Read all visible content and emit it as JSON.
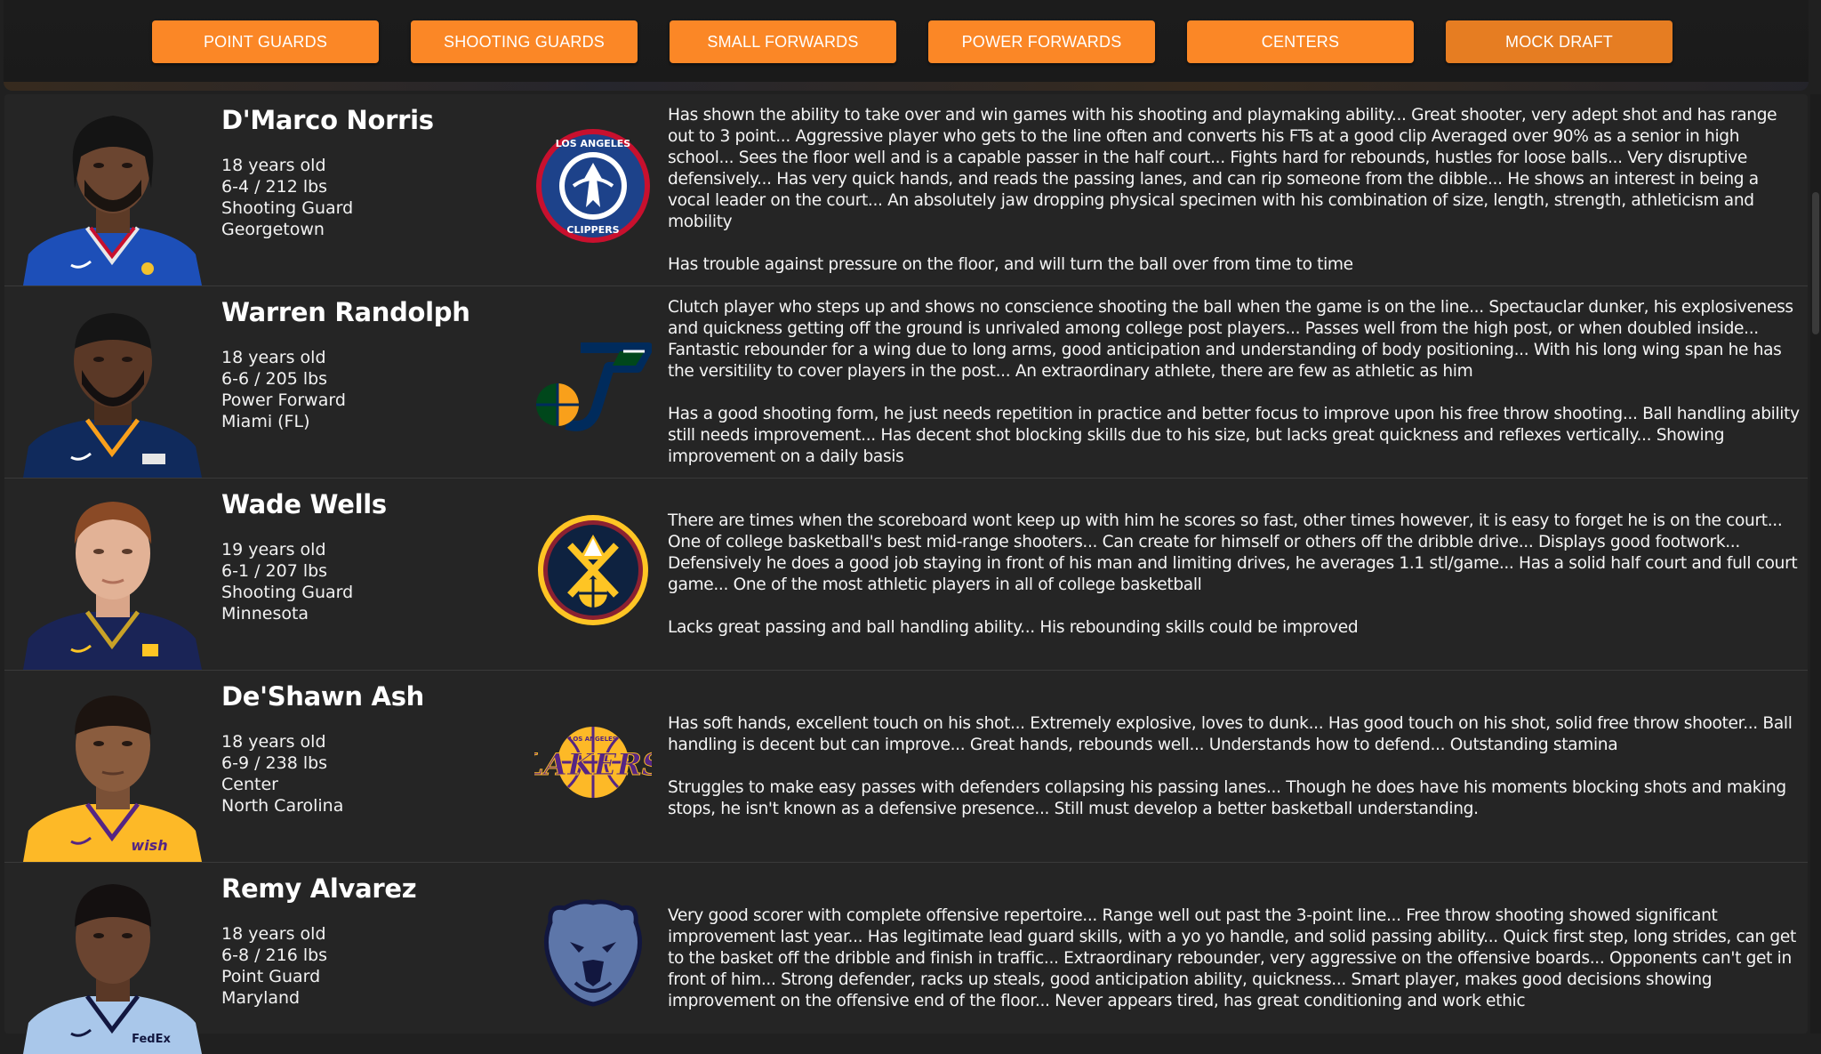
{
  "nav": {
    "buttons": [
      "POINT GUARDS",
      "SHOOTING GUARDS",
      "SMALL FORWARDS",
      "POWER FORWARDS",
      "CENTERS",
      "MOCK DRAFT"
    ]
  },
  "colors": {
    "accent": "#fb8726",
    "background": "#202020",
    "row_background": "#252525"
  },
  "players": [
    {
      "name": "D'Marco Norris",
      "age": "18 years old",
      "size": "6-4 / 212 lbs",
      "position": "Shooting Guard",
      "school": "Georgetown",
      "team_logo": "clippers-logo",
      "jersey": "clippers",
      "strengths": "Has shown the ability to take over and win games with his shooting and playmaking ability... Great shooter, very adept shot and has range out to 3 point... Aggressive player who gets to the line often and converts his FTs at a good clip Averaged over 90% as a senior in high school... Sees the floor well and is a capable passer in the half court... Fights hard for rebounds, hustles for loose balls... Very disruptive defensively... Has very quick hands, and reads the passing lanes, and can rip someone from the dibble... He shows an interest in being a vocal leader on the court... An absolutely jaw dropping physical specimen with his combination of size, length, strength, athleticism and mobility",
      "weaknesses": "Has trouble against pressure on the floor, and will turn the ball over from time to time"
    },
    {
      "name": "Warren Randolph",
      "age": "18 years old",
      "size": "6-6 / 205 lbs",
      "position": "Power Forward",
      "school": "Miami (FL)",
      "team_logo": "jazz-logo",
      "jersey": "jazz",
      "strengths": "Clutch player who steps up and shows no conscience shooting the ball when the game is on the line... Spectauclar dunker, his explosiveness and quickness getting off the ground is unrivaled among college post players... Passes well from the high post, or when doubled inside... Fantastic rebounder for a wing due to long arms, good anticipation and understanding of body positioning... With his long wing span he has the versitility to cover players in the post... An extraordinary athlete, there are few as athletic as him",
      "weaknesses": "Has a good shooting form, he just needs repetition in practice and better focus to improve upon his free throw shooting... Ball handling ability still needs improvement... Has decent shot blocking skills due to his size, but lacks great quickness and reflexes vertically... Showing improvement on a daily basis"
    },
    {
      "name": "Wade Wells",
      "age": "19 years old",
      "size": "6-1 / 207 lbs",
      "position": "Shooting Guard",
      "school": "Minnesota",
      "team_logo": "nuggets-logo",
      "jersey": "nuggets",
      "strengths": "There are times when the scoreboard wont keep up with him he scores so fast, other times however, it is easy to forget he is on the court... One of college basketball's best mid-range shooters... Can create for himself or others off the dribble drive... Displays good footwork... Defensively he does a good job staying in front of his man and limiting drives, he averages 1.1 stl/game... Has a solid half court and full court game... One of the most athletic players in all of college basketball",
      "weaknesses": "Lacks great passing and ball handling ability... His rebounding skills could be improved"
    },
    {
      "name": "De'Shawn Ash",
      "age": "18 years old",
      "size": "6-9 / 238 lbs",
      "position": "Center",
      "school": "North Carolina",
      "team_logo": "lakers-logo",
      "jersey": "lakers",
      "strengths": "Has soft hands, excellent touch on his shot... Extremely explosive, loves to dunk... Has good touch on his shot, solid free throw shooter... Ball handling is decent but can improve... Great hands, rebounds well... Understands how to defend... Outstanding stamina",
      "weaknesses": "Struggles to make easy passes with defenders collapsing his passing lanes... Though he does have his moments blocking shots and making stops, he isn't known as a defensive presence... Still must develop a better basketball understanding."
    },
    {
      "name": "Remy Alvarez",
      "age": "18 years old",
      "size": "6-8 / 216 lbs",
      "position": "Point Guard",
      "school": "Maryland",
      "team_logo": "grizzlies-logo",
      "jersey": "grizzlies",
      "strengths": "Very good scorer with complete offensive repertoire... Range well out past the 3-point line... Free throw shooting showed significant improvement last year... Has legitimate lead guard skills, with a yo yo handle, and solid passing ability... Quick first step, long strides, can get to the basket off the dribble and finish in traffic... Extraordinary rebounder, very aggressive on the offensive boards... Opponents can't get in front of him... Strong defender, racks up steals, good anticipation ability, quickness... Smart player, makes good decisions showing improvement on the offensive end of the floor... Never appears tired, has great conditioning and work ethic",
      "weaknesses": ""
    }
  ]
}
